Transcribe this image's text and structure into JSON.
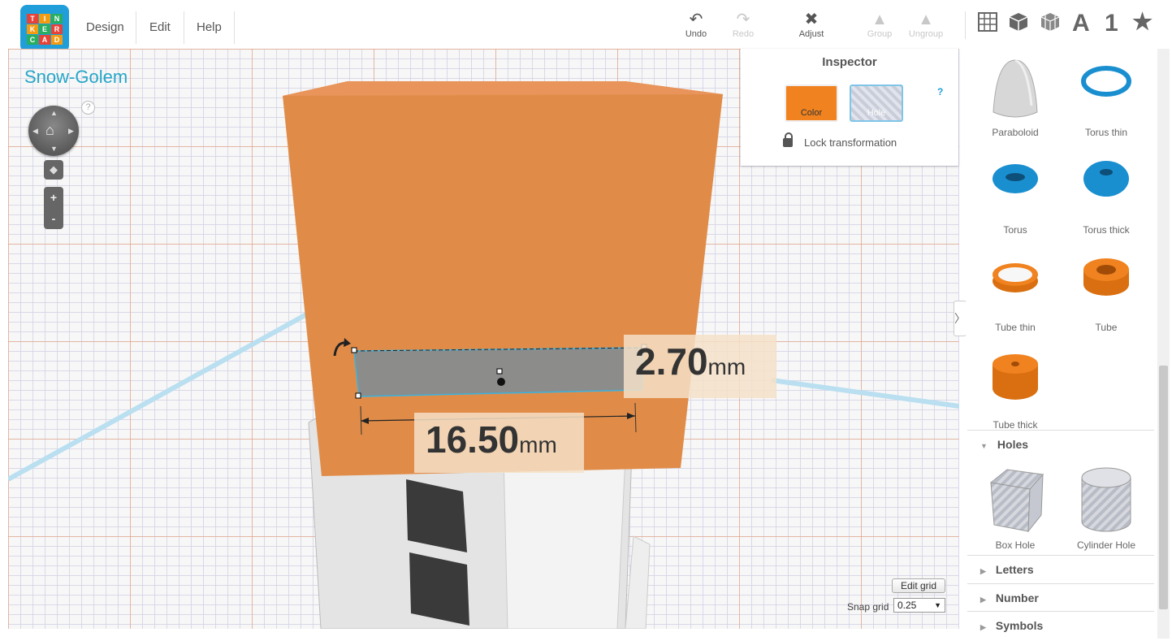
{
  "logo": {
    "letters": [
      "T",
      "I",
      "N",
      "K",
      "E",
      "R",
      "C",
      "A",
      "D"
    ]
  },
  "menu": {
    "design": "Design",
    "edit": "Edit",
    "help": "Help"
  },
  "toolbar": {
    "undo": "Undo",
    "redo": "Redo",
    "adjust": "Adjust",
    "group": "Group",
    "ungroup": "Ungroup"
  },
  "view_toolbar": {
    "letters_icon": "A",
    "number_icon": "1",
    "favorites_icon": "★"
  },
  "design": {
    "title": "Snow-Golem",
    "help": "?"
  },
  "dimensions": {
    "height_value": "2.70",
    "height_unit": "mm",
    "width_value": "16.50",
    "width_unit": "mm"
  },
  "inspector": {
    "title": "Inspector",
    "color_label": "Color",
    "hole_label": "Hole",
    "help": "?",
    "lock_label": "Lock transformation",
    "color_hex": "#f0821f"
  },
  "grid": {
    "edit_label": "Edit grid",
    "snap_label": "Snap grid",
    "snap_value": "0.25"
  },
  "shapes": [
    {
      "name": "Paraboloid"
    },
    {
      "name": "Torus thin"
    },
    {
      "name": "Torus"
    },
    {
      "name": "Torus thick"
    },
    {
      "name": "Tube thin"
    },
    {
      "name": "Tube"
    },
    {
      "name": "Tube thick"
    }
  ],
  "sections": {
    "holes": "Holes",
    "letters": "Letters",
    "number": "Number",
    "symbols": "Symbols"
  },
  "holes": [
    {
      "name": "Box Hole"
    },
    {
      "name": "Cylinder Hole"
    }
  ],
  "colors": {
    "accent": "#1f9ed9",
    "orange": "#f0821f",
    "title": "#26a6c8"
  }
}
